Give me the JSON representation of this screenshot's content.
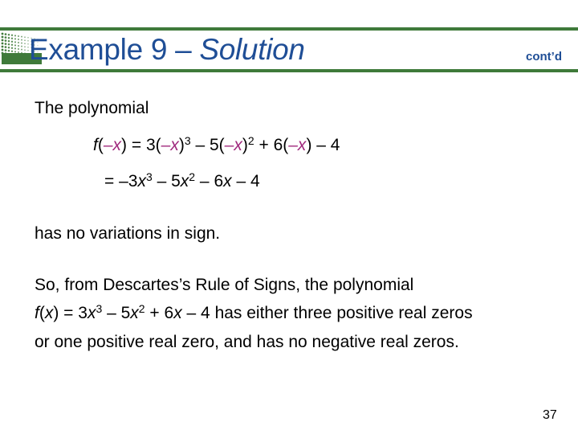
{
  "header": {
    "title_main": "Example 9 – ",
    "title_italic": "Solution",
    "contd": "cont’d"
  },
  "body": {
    "intro": "The polynomial",
    "eq1": {
      "f": "f",
      "open": "(",
      "negx": "–x",
      "mid1": ") = 3(",
      "mid1_close": ")",
      "exp3": "3",
      "mid2": " – 5(",
      "mid2_close": ")",
      "exp2": "2",
      "mid3": " + 6(",
      "tail": ") – 4"
    },
    "eq2": {
      "lead": "= –3",
      "x": "x",
      "exp3": "3",
      "part2": " – 5",
      "exp2": "2",
      "part3": " – 6",
      "tail": " – 4"
    },
    "no_variations": "has no variations in sign.",
    "conclusion_line1": "So, from Descartes’s Rule of Signs, the polynomial",
    "conclusion_line2": {
      "f": "f",
      "open": "(",
      "x": "x",
      "close": ") = 3",
      "exp3": "3",
      "part2": " – 5",
      "exp2": "2",
      "part3": " + 6",
      "tail": " – 4 has either three positive real zeros"
    },
    "conclusion_line3": "or one positive real zero, and has no negative real zeros."
  },
  "footer": {
    "page_number": "37"
  },
  "colors": {
    "accent_green": "#3f7a3a",
    "title_blue": "#1f4e96",
    "negative_highlight": "#a0287d"
  }
}
